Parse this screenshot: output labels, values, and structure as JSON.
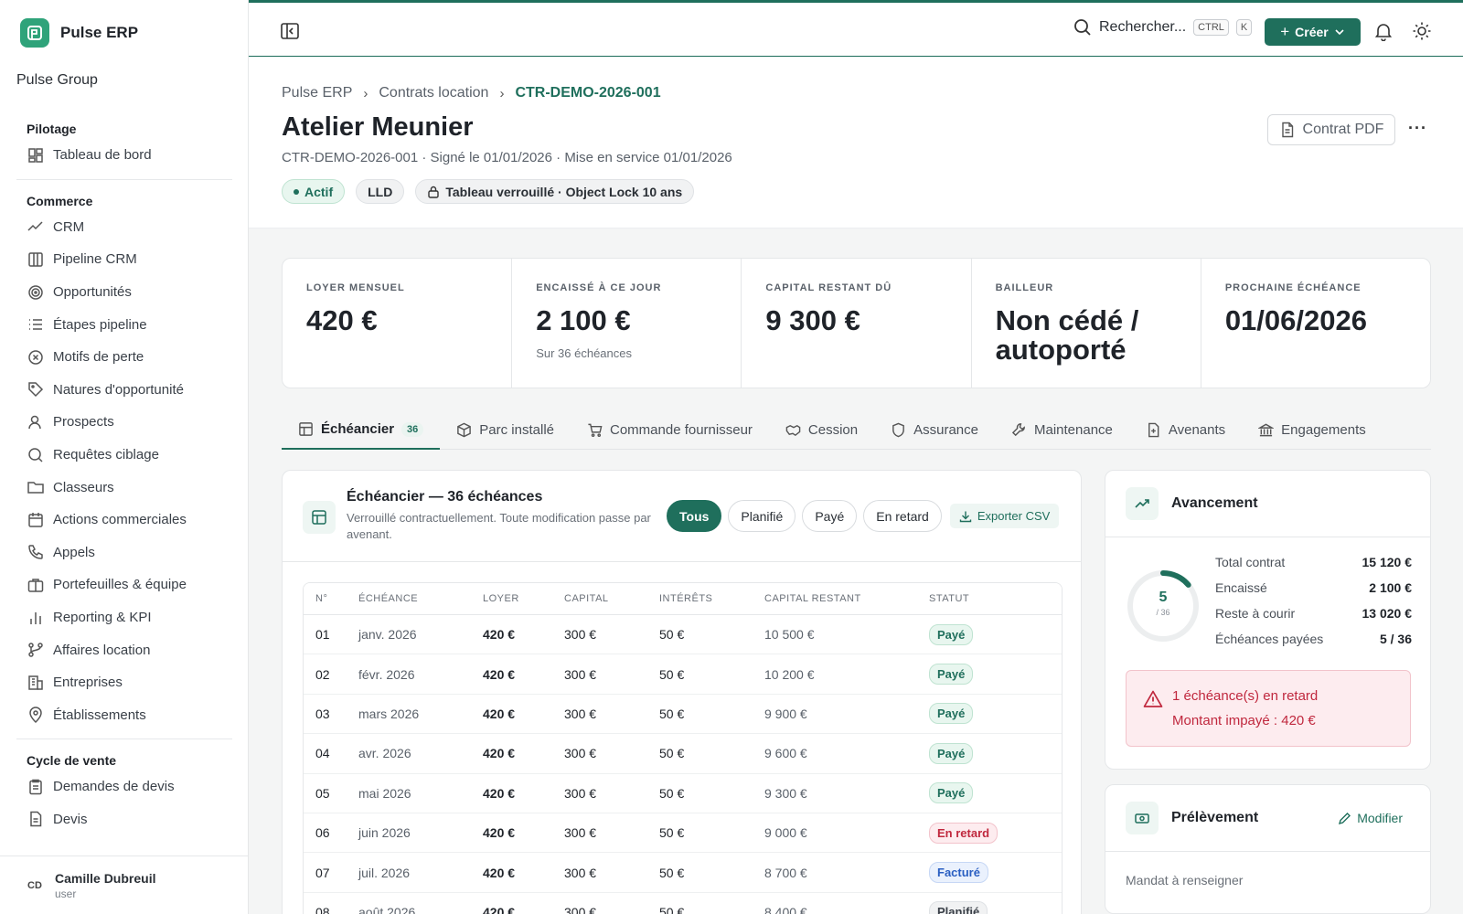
{
  "app": {
    "name": "Pulse ERP",
    "org": "Pulse Group"
  },
  "sidebar": {
    "sections": [
      {
        "label": "Pilotage",
        "items": [
          "Tableau de bord"
        ]
      },
      {
        "label": "Commerce",
        "items": [
          "CRM",
          "Pipeline CRM",
          "Opportunités",
          "Étapes pipeline",
          "Motifs de perte",
          "Natures d'opportunité",
          "Prospects",
          "Requêtes ciblage",
          "Classeurs",
          "Actions commerciales",
          "Appels",
          "Portefeuilles & équipe",
          "Reporting & KPI",
          "Affaires location",
          "Entreprises",
          "Établissements"
        ]
      },
      {
        "label": "Cycle de vente",
        "items": [
          "Demandes de devis",
          "Devis"
        ]
      }
    ],
    "user": {
      "initials": "CD",
      "name": "Camille Dubreuil",
      "role": "user"
    }
  },
  "topbar": {
    "search_label": "Rechercher...",
    "kbd1": "CTRL",
    "kbd2": "K",
    "create_label": "Créer"
  },
  "header": {
    "breadcrumb": [
      "Pulse ERP",
      "Contrats location",
      "CTR-DEMO-2026-001"
    ],
    "title": "Atelier Meunier",
    "subtitle": "CTR-DEMO-2026-001 · Signé le 01/01/2026 · Mise en service 01/01/2026",
    "badges": {
      "status": "Actif",
      "type": "LLD",
      "lock": "Tableau verrouillé · Object Lock 10 ans"
    },
    "pdf_label": "Contrat PDF",
    "more_label": "···"
  },
  "stats": [
    {
      "label": "LOYER MENSUEL",
      "value": "420 €",
      "sub": ""
    },
    {
      "label": "ENCAISSÉ À CE JOUR",
      "value": "2 100 €",
      "sub": "Sur 36 échéances"
    },
    {
      "label": "CAPITAL RESTANT DÛ",
      "value": "9 300 €",
      "sub": ""
    },
    {
      "label": "BAILLEUR",
      "value": "Non cédé / autoporté",
      "sub": ""
    },
    {
      "label": "PROCHAINE ÉCHÉANCE",
      "value": "01/06/2026",
      "sub": ""
    }
  ],
  "tabs": [
    {
      "label": "Échéancier",
      "count": "36"
    },
    {
      "label": "Parc installé"
    },
    {
      "label": "Commande fournisseur"
    },
    {
      "label": "Cession"
    },
    {
      "label": "Assurance"
    },
    {
      "label": "Maintenance"
    },
    {
      "label": "Avenants"
    },
    {
      "label": "Engagements"
    }
  ],
  "schedule": {
    "title": "Échéancier — 36 échéances",
    "desc": "Verrouillé contractuellement. Toute modification passe par avenant.",
    "filters": [
      "Tous",
      "Planifié",
      "Payé",
      "En retard"
    ],
    "export_label": "Exporter CSV",
    "columns": [
      "N°",
      "ÉCHÉANCE",
      "LOYER",
      "CAPITAL",
      "INTÉRÊTS",
      "CAPITAL RESTANT",
      "STATUT"
    ],
    "rows": [
      [
        "01",
        "janv. 2026",
        "420 €",
        "300 €",
        "50 €",
        "10 500 €",
        "Payé"
      ],
      [
        "02",
        "févr. 2026",
        "420 €",
        "300 €",
        "50 €",
        "10 200 €",
        "Payé"
      ],
      [
        "03",
        "mars 2026",
        "420 €",
        "300 €",
        "50 €",
        "9 900 €",
        "Payé"
      ],
      [
        "04",
        "avr. 2026",
        "420 €",
        "300 €",
        "50 €",
        "9 600 €",
        "Payé"
      ],
      [
        "05",
        "mai 2026",
        "420 €",
        "300 €",
        "50 €",
        "9 300 €",
        "Payé"
      ],
      [
        "06",
        "juin 2026",
        "420 €",
        "300 €",
        "50 €",
        "9 000 €",
        "En retard"
      ],
      [
        "07",
        "juil. 2026",
        "420 €",
        "300 €",
        "50 €",
        "8 700 €",
        "Facturé"
      ],
      [
        "08",
        "août 2026",
        "420 €",
        "300 €",
        "50 €",
        "8 400 €",
        "Planifié"
      ]
    ]
  },
  "progress": {
    "title": "Avancement",
    "paid": "5",
    "total": "/ 36",
    "fraction": 0.139,
    "rows": [
      {
        "k": "Total contrat",
        "v": "15 120 €"
      },
      {
        "k": "Encaissé",
        "v": "2 100 €"
      },
      {
        "k": "Reste à courir",
        "v": "13 020 €"
      },
      {
        "k": "Échéances payées",
        "v": "5 / 36"
      }
    ],
    "alert_line1": "1 échéance(s) en retard",
    "alert_line2": "Montant impayé : 420 €"
  },
  "prelevement": {
    "title": "Prélèvement",
    "edit_label": "Modifier",
    "mandat": "Mandat à renseigner"
  },
  "colors": {
    "accent": "#1f6f5c",
    "danger": "#c0283e"
  }
}
